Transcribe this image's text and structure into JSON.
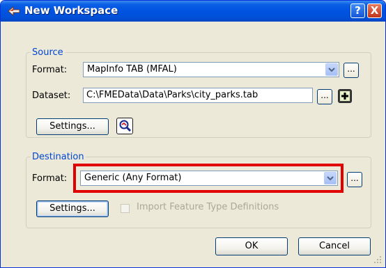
{
  "window": {
    "title": "New Workspace",
    "help_label": "?",
    "close_label": "X"
  },
  "source": {
    "legend": "Source",
    "format_label": "Format:",
    "format_value": "MapInfo TAB (MFAL)",
    "format_browse": "...",
    "dataset_label": "Dataset:",
    "dataset_value": "C:\\FMEData\\Data\\Parks\\city_parks.tab",
    "dataset_browse": "...",
    "add_icon": "plus-icon",
    "settings_label": "Settings...",
    "inspect_icon": "magnifier-icon"
  },
  "destination": {
    "legend": "Destination",
    "format_label": "Format:",
    "format_value": "Generic (Any Format)",
    "format_browse": "...",
    "settings_label": "Settings...",
    "import_label": "Import Feature Type Definitions",
    "import_checked": false
  },
  "buttons": {
    "ok_label": "OK",
    "cancel_label": "Cancel"
  },
  "colors": {
    "titlebar": "#0054e3",
    "legend": "#0046d5",
    "highlight": "#e00000"
  }
}
